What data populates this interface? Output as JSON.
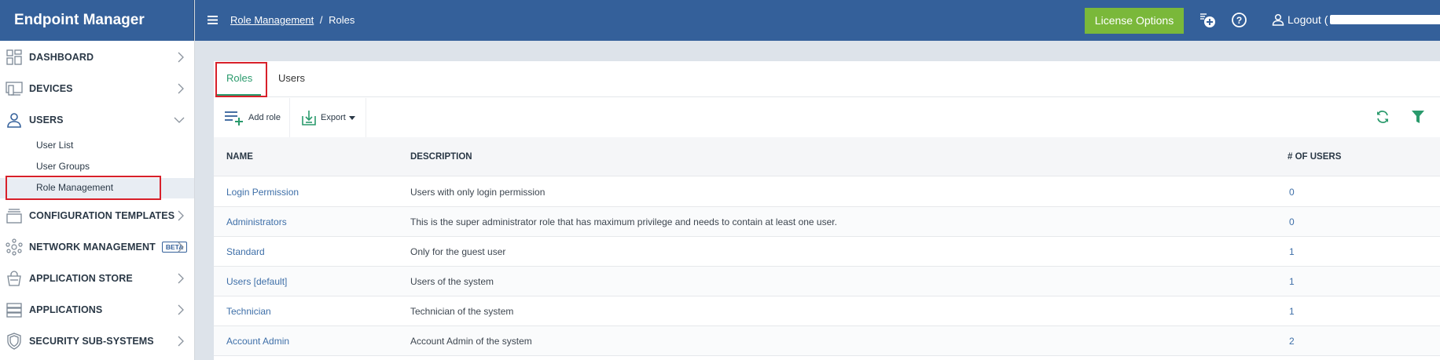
{
  "app": {
    "title": "Endpoint Manager"
  },
  "sidebar": {
    "items": [
      {
        "label": "DASHBOARD",
        "icon": "dashboard-icon"
      },
      {
        "label": "DEVICES",
        "icon": "devices-icon"
      },
      {
        "label": "USERS",
        "icon": "user-icon",
        "expanded": true
      },
      {
        "label": "CONFIGURATION TEMPLATES",
        "icon": "config-templates-icon"
      },
      {
        "label": "NETWORK MANAGEMENT",
        "icon": "network-icon",
        "badge": "BETA"
      },
      {
        "label": "APPLICATION STORE",
        "icon": "app-store-icon"
      },
      {
        "label": "APPLICATIONS",
        "icon": "applications-icon"
      },
      {
        "label": "SECURITY SUB-SYSTEMS",
        "icon": "shield-icon"
      }
    ],
    "users_sub": [
      "User List",
      "User Groups",
      "Role Management"
    ],
    "active_sub": "Role Management"
  },
  "header": {
    "breadcrumb": {
      "parent": "Role Management",
      "separator": "/",
      "current": "Roles"
    },
    "license_button": "License Options",
    "logout_label": "Logout ("
  },
  "tabs": [
    {
      "label": "Roles",
      "active": true
    },
    {
      "label": "Users",
      "active": false
    }
  ],
  "toolbar": {
    "add_role": "Add role",
    "export": "Export"
  },
  "table": {
    "columns": [
      "NAME",
      "DESCRIPTION",
      "# OF USERS"
    ],
    "rows": [
      {
        "name": "Login Permission",
        "description": "Users with only login permission",
        "users": "0"
      },
      {
        "name": "Administrators",
        "description": "This is the super administrator role that has maximum privilege and needs to contain at least one user.",
        "users": "0"
      },
      {
        "name": "Standard",
        "description": "Only for the guest user",
        "users": "1"
      },
      {
        "name": "Users [default]",
        "description": "Users of the system",
        "users": "1"
      },
      {
        "name": "Technician",
        "description": "Technician of the system",
        "users": "1"
      },
      {
        "name": "Account Admin",
        "description": "Account Admin of the system",
        "users": "2"
      }
    ]
  },
  "colors": {
    "brand": "#34609a",
    "accent_green": "#2a9a6c",
    "license_green": "#7ab83a",
    "highlight_red": "#d8202a",
    "link": "#3e6fa8"
  }
}
